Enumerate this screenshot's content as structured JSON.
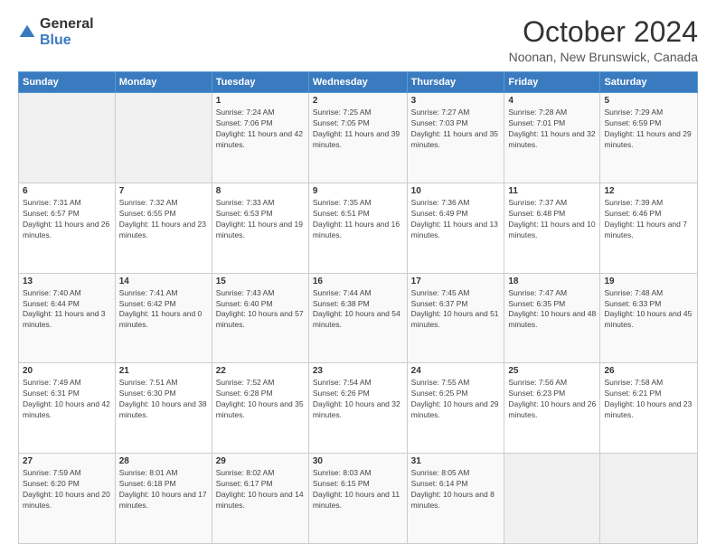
{
  "header": {
    "logo_general": "General",
    "logo_blue": "Blue",
    "month": "October 2024",
    "location": "Noonan, New Brunswick, Canada"
  },
  "weekdays": [
    "Sunday",
    "Monday",
    "Tuesday",
    "Wednesday",
    "Thursday",
    "Friday",
    "Saturday"
  ],
  "weeks": [
    [
      {
        "day": "",
        "detail": ""
      },
      {
        "day": "",
        "detail": ""
      },
      {
        "day": "1",
        "detail": "Sunrise: 7:24 AM\nSunset: 7:06 PM\nDaylight: 11 hours and 42 minutes."
      },
      {
        "day": "2",
        "detail": "Sunrise: 7:25 AM\nSunset: 7:05 PM\nDaylight: 11 hours and 39 minutes."
      },
      {
        "day": "3",
        "detail": "Sunrise: 7:27 AM\nSunset: 7:03 PM\nDaylight: 11 hours and 35 minutes."
      },
      {
        "day": "4",
        "detail": "Sunrise: 7:28 AM\nSunset: 7:01 PM\nDaylight: 11 hours and 32 minutes."
      },
      {
        "day": "5",
        "detail": "Sunrise: 7:29 AM\nSunset: 6:59 PM\nDaylight: 11 hours and 29 minutes."
      }
    ],
    [
      {
        "day": "6",
        "detail": "Sunrise: 7:31 AM\nSunset: 6:57 PM\nDaylight: 11 hours and 26 minutes."
      },
      {
        "day": "7",
        "detail": "Sunrise: 7:32 AM\nSunset: 6:55 PM\nDaylight: 11 hours and 23 minutes."
      },
      {
        "day": "8",
        "detail": "Sunrise: 7:33 AM\nSunset: 6:53 PM\nDaylight: 11 hours and 19 minutes."
      },
      {
        "day": "9",
        "detail": "Sunrise: 7:35 AM\nSunset: 6:51 PM\nDaylight: 11 hours and 16 minutes."
      },
      {
        "day": "10",
        "detail": "Sunrise: 7:36 AM\nSunset: 6:49 PM\nDaylight: 11 hours and 13 minutes."
      },
      {
        "day": "11",
        "detail": "Sunrise: 7:37 AM\nSunset: 6:48 PM\nDaylight: 11 hours and 10 minutes."
      },
      {
        "day": "12",
        "detail": "Sunrise: 7:39 AM\nSunset: 6:46 PM\nDaylight: 11 hours and 7 minutes."
      }
    ],
    [
      {
        "day": "13",
        "detail": "Sunrise: 7:40 AM\nSunset: 6:44 PM\nDaylight: 11 hours and 3 minutes."
      },
      {
        "day": "14",
        "detail": "Sunrise: 7:41 AM\nSunset: 6:42 PM\nDaylight: 11 hours and 0 minutes."
      },
      {
        "day": "15",
        "detail": "Sunrise: 7:43 AM\nSunset: 6:40 PM\nDaylight: 10 hours and 57 minutes."
      },
      {
        "day": "16",
        "detail": "Sunrise: 7:44 AM\nSunset: 6:38 PM\nDaylight: 10 hours and 54 minutes."
      },
      {
        "day": "17",
        "detail": "Sunrise: 7:45 AM\nSunset: 6:37 PM\nDaylight: 10 hours and 51 minutes."
      },
      {
        "day": "18",
        "detail": "Sunrise: 7:47 AM\nSunset: 6:35 PM\nDaylight: 10 hours and 48 minutes."
      },
      {
        "day": "19",
        "detail": "Sunrise: 7:48 AM\nSunset: 6:33 PM\nDaylight: 10 hours and 45 minutes."
      }
    ],
    [
      {
        "day": "20",
        "detail": "Sunrise: 7:49 AM\nSunset: 6:31 PM\nDaylight: 10 hours and 42 minutes."
      },
      {
        "day": "21",
        "detail": "Sunrise: 7:51 AM\nSunset: 6:30 PM\nDaylight: 10 hours and 38 minutes."
      },
      {
        "day": "22",
        "detail": "Sunrise: 7:52 AM\nSunset: 6:28 PM\nDaylight: 10 hours and 35 minutes."
      },
      {
        "day": "23",
        "detail": "Sunrise: 7:54 AM\nSunset: 6:26 PM\nDaylight: 10 hours and 32 minutes."
      },
      {
        "day": "24",
        "detail": "Sunrise: 7:55 AM\nSunset: 6:25 PM\nDaylight: 10 hours and 29 minutes."
      },
      {
        "day": "25",
        "detail": "Sunrise: 7:56 AM\nSunset: 6:23 PM\nDaylight: 10 hours and 26 minutes."
      },
      {
        "day": "26",
        "detail": "Sunrise: 7:58 AM\nSunset: 6:21 PM\nDaylight: 10 hours and 23 minutes."
      }
    ],
    [
      {
        "day": "27",
        "detail": "Sunrise: 7:59 AM\nSunset: 6:20 PM\nDaylight: 10 hours and 20 minutes."
      },
      {
        "day": "28",
        "detail": "Sunrise: 8:01 AM\nSunset: 6:18 PM\nDaylight: 10 hours and 17 minutes."
      },
      {
        "day": "29",
        "detail": "Sunrise: 8:02 AM\nSunset: 6:17 PM\nDaylight: 10 hours and 14 minutes."
      },
      {
        "day": "30",
        "detail": "Sunrise: 8:03 AM\nSunset: 6:15 PM\nDaylight: 10 hours and 11 minutes."
      },
      {
        "day": "31",
        "detail": "Sunrise: 8:05 AM\nSunset: 6:14 PM\nDaylight: 10 hours and 8 minutes."
      },
      {
        "day": "",
        "detail": ""
      },
      {
        "day": "",
        "detail": ""
      }
    ]
  ]
}
